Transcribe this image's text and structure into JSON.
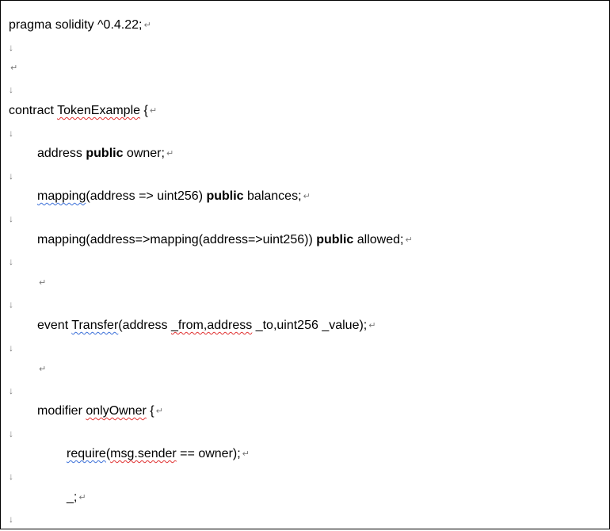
{
  "glyphs": {
    "paragraph_mark": "↵",
    "line_break_mark": "↓"
  },
  "colors": {
    "spelling_squiggle": "#e03030",
    "grammar_squiggle": "#3a6fd8",
    "formatting_mark": "#7a7a7a"
  },
  "code": {
    "pragma": "pragma solidity ^0.4.22;",
    "contract_kw": "contract ",
    "contract_name": "TokenExample",
    "contract_open": " {",
    "owner_pre": "address ",
    "public_kw": "public",
    "owner_post": " owner;",
    "balances_fn": "mapping",
    "balances_pre": "(address => uint256) ",
    "balances_post": " balances;",
    "allowed_pre": "mapping(address=>mapping(address=>uint256)) ",
    "allowed_post": " allowed;",
    "event_kw": "event ",
    "event_name": "Transfer",
    "event_pre": "(address ",
    "event_from": "_from,address",
    "event_post": " _to,uint256 _value);",
    "modifier_kw": "modifier ",
    "modifier_name": "onlyOwner",
    "modifier_open": " {",
    "require_fn": "require",
    "require_paren": "(",
    "require_arg": "msg.sender",
    "require_post": " == owner);",
    "placeholder": "_;"
  }
}
